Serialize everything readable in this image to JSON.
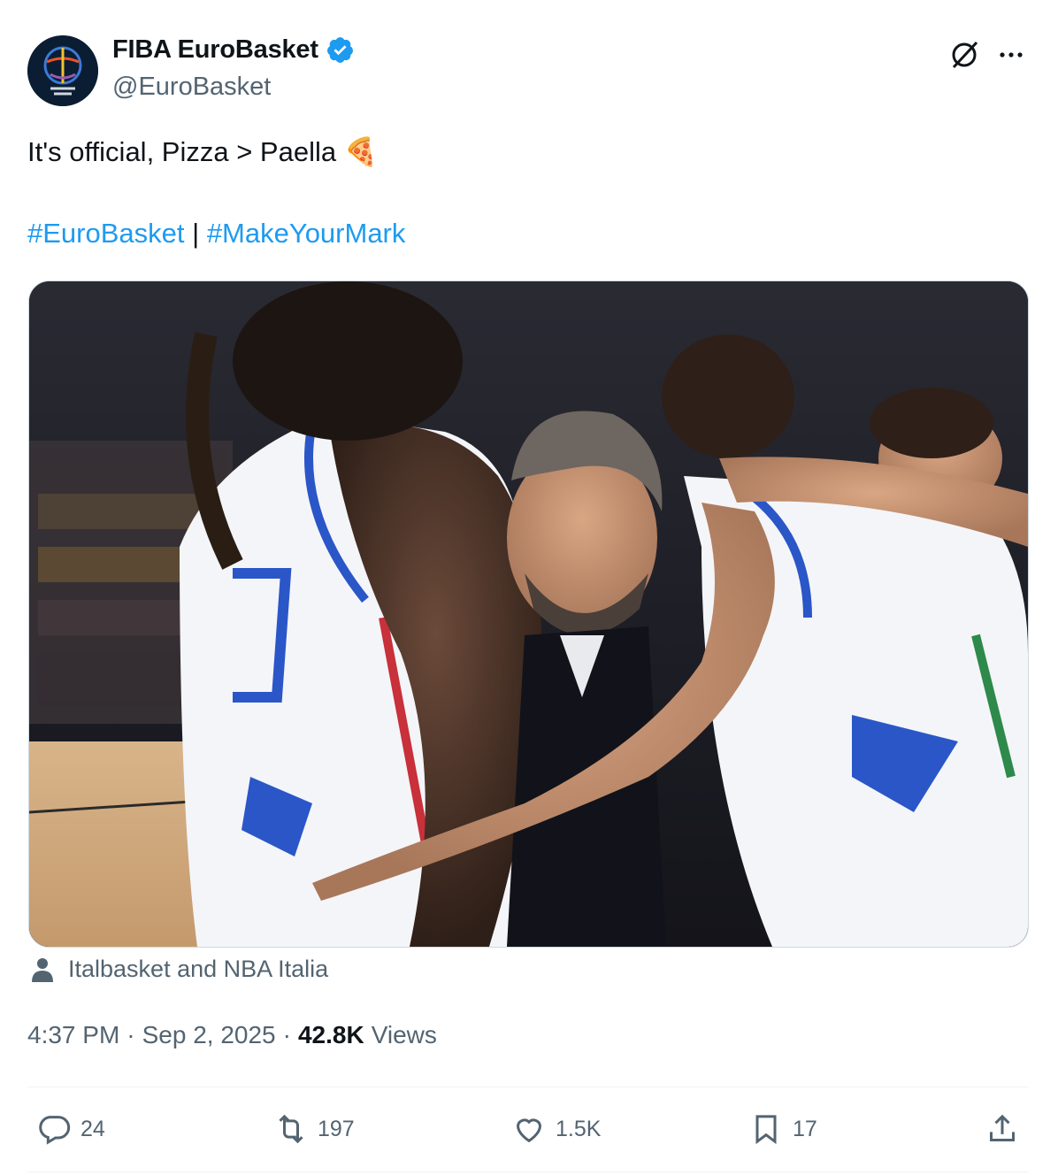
{
  "account": {
    "display_name": "FIBA EuroBasket",
    "handle": "@EuroBasket",
    "verified": true,
    "avatar_icon": "eurobasket-logo-icon"
  },
  "tweet": {
    "text": "It's official, Pizza > Paella",
    "emoji": "🍕",
    "hashtags": [
      "#EuroBasket",
      "#MakeYourMark"
    ],
    "separator": "|"
  },
  "media": {
    "tagged": "Italbasket and NBA Italia"
  },
  "meta": {
    "time": "4:37 PM",
    "date": "Sep 2, 2025",
    "views_count": "42.8K",
    "views_label": "Views",
    "dot": "·"
  },
  "actions": {
    "replies": "24",
    "reposts": "197",
    "likes": "1.5K",
    "bookmarks": "17"
  },
  "colors": {
    "accent": "#1d9bf0",
    "text": "#0f1419",
    "secondary": "#536471",
    "divider": "#eff3f4"
  }
}
